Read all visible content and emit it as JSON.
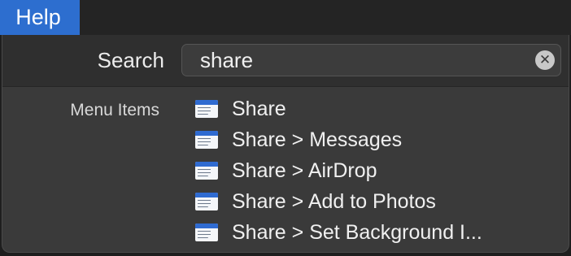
{
  "menubar": {
    "help_label": "Help"
  },
  "search": {
    "label": "Search",
    "value": "share",
    "clear_symbol": "✕"
  },
  "results": {
    "section_label": "Menu Items",
    "items": [
      {
        "label": "Share",
        "icon": "menu-item-icon"
      },
      {
        "label": "Share > Messages",
        "icon": "menu-item-icon"
      },
      {
        "label": "Share > AirDrop",
        "icon": "menu-item-icon"
      },
      {
        "label": "Share > Add to Photos",
        "icon": "menu-item-icon"
      },
      {
        "label": "Share > Set Background I...",
        "icon": "menu-item-icon"
      }
    ]
  },
  "colors": {
    "accent": "#2d6ecf",
    "panel_background": "#3a3a3a",
    "text": "#f0f0f0"
  }
}
